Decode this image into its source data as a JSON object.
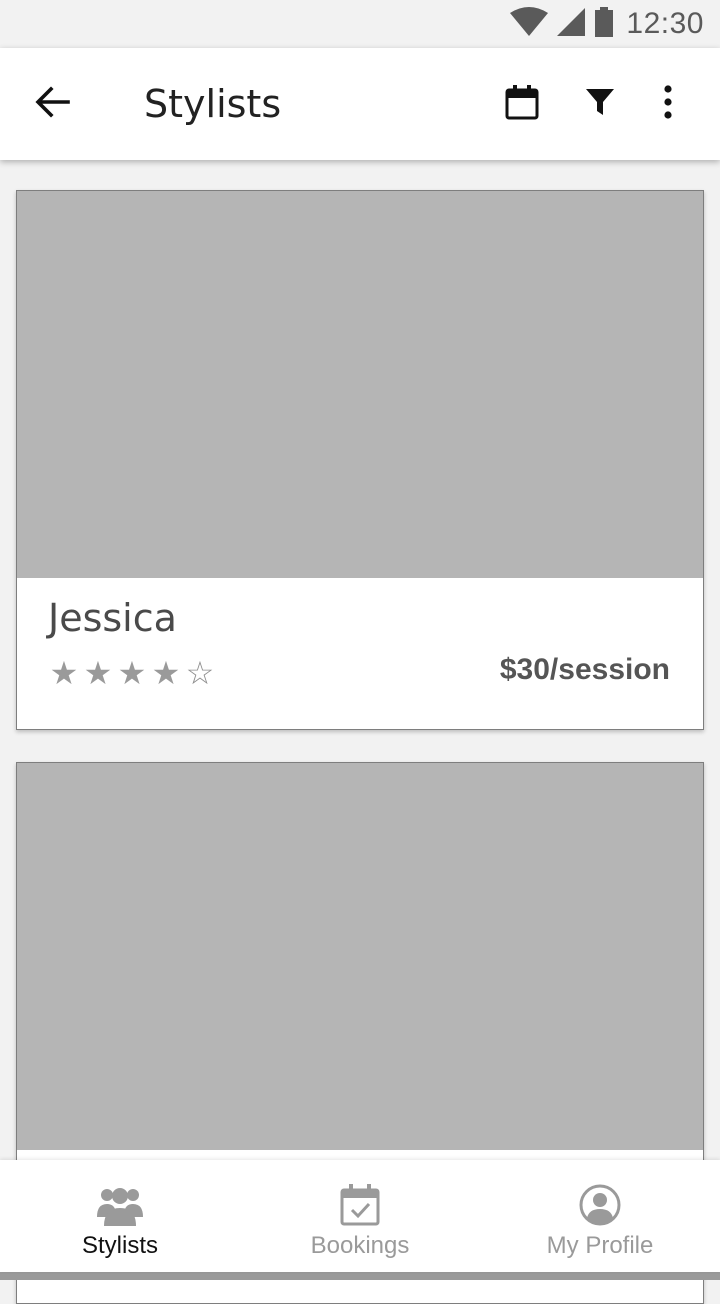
{
  "status_bar": {
    "time": "12:30",
    "icons": [
      "wifi-icon",
      "signal-icon",
      "battery-icon"
    ]
  },
  "app_bar": {
    "title": "Stylists",
    "back_icon": "arrow-left-icon",
    "actions": [
      "calendar-icon",
      "filter-icon",
      "more-vert-icon"
    ]
  },
  "stylists": [
    {
      "name": "Jessica",
      "rating": 4,
      "rating_max": 5,
      "price": "$30/session"
    }
  ],
  "bottom_nav": {
    "items": [
      {
        "label": "Stylists",
        "icon": "group-icon",
        "active": true
      },
      {
        "label": "Bookings",
        "icon": "calendar-check-icon",
        "active": false
      },
      {
        "label": "My Profile",
        "icon": "account-circle-icon",
        "active": false
      }
    ]
  },
  "colors": {
    "image_placeholder": "#b5b5b5",
    "title_text": "#222222",
    "inactive_nav": "#9a9a9a",
    "active_nav": "#111111"
  }
}
